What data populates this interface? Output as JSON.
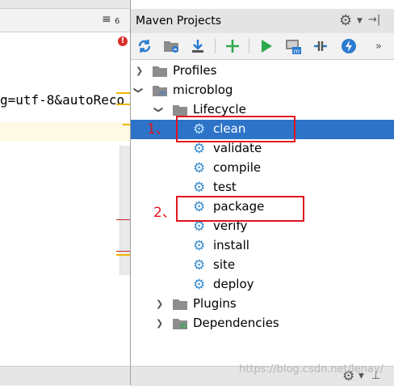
{
  "editor": {
    "num_label": "6",
    "error_glyph": "!",
    "code_text": "g=utf-8&autoReco"
  },
  "panel": {
    "title": "Maven Projects"
  },
  "toolbar": {
    "buttons": [
      "reimport-icon",
      "generate-sources-icon",
      "download-icon",
      "add-icon",
      "run-icon",
      "execute-goal-icon",
      "toggle-offline-icon",
      "skip-tests-icon",
      "more-icon"
    ]
  },
  "tree": {
    "profiles": "Profiles",
    "project": "microblog",
    "lifecycle": "Lifecycle",
    "phases": [
      "clean",
      "validate",
      "compile",
      "test",
      "package",
      "verify",
      "install",
      "site",
      "deploy"
    ],
    "plugins": "Plugins",
    "dependencies": "Dependencies"
  },
  "annotations": {
    "step1": "1、",
    "step2": "2、"
  },
  "watermark": "https://blog.csdn.net/lenay/",
  "colors": {
    "selection": "#2d73c8",
    "annotation": "#e0141e",
    "gear": "#3a8fd1",
    "run": "#2fa84f"
  }
}
